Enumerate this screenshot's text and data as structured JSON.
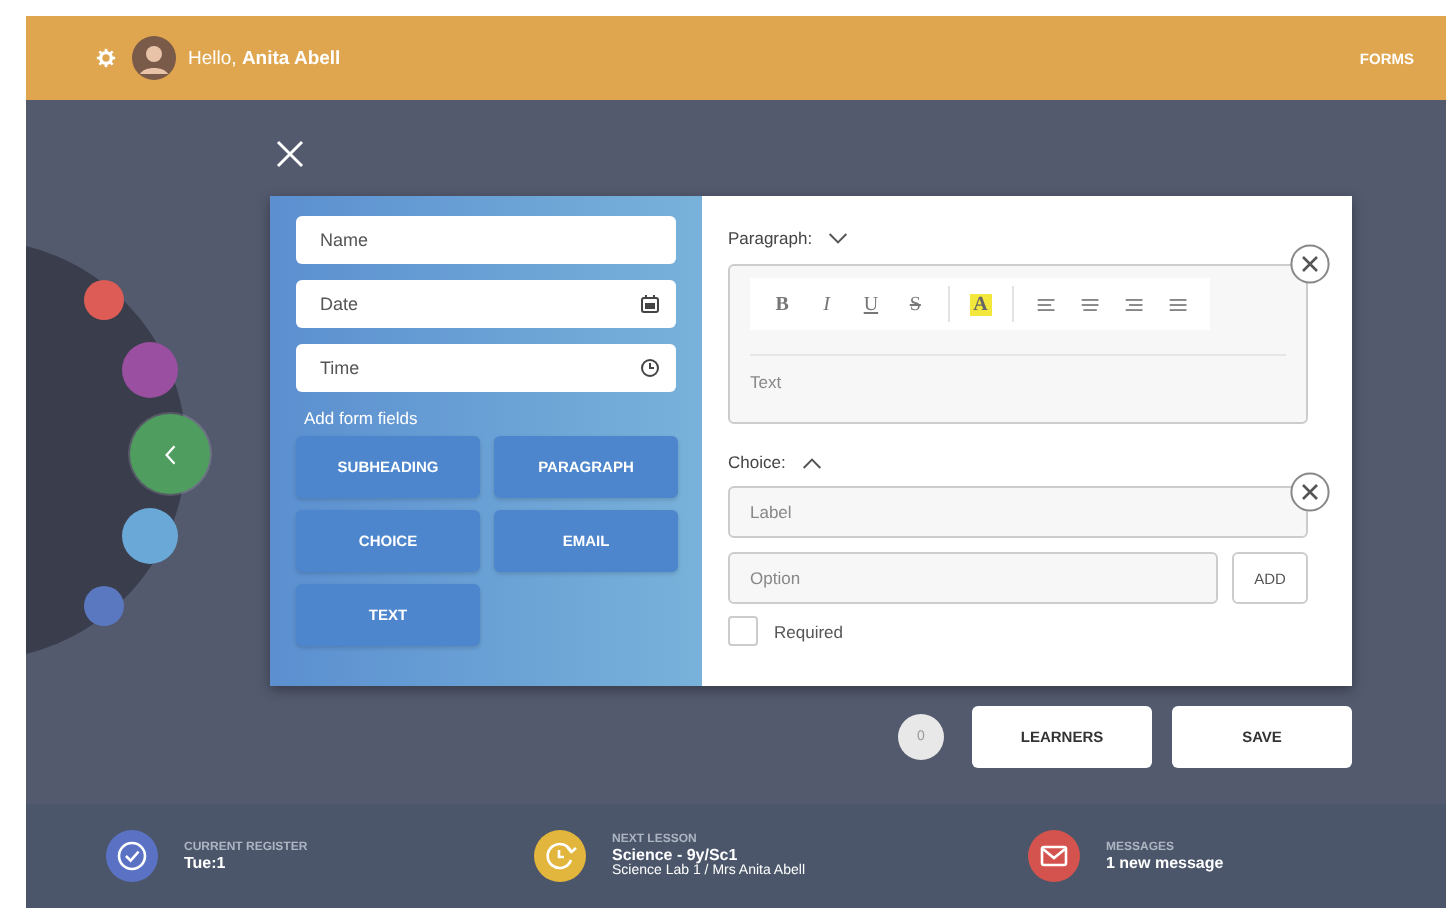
{
  "header": {
    "greeting": "Hello, **Anita Abell**",
    "nav_link": "FORMS"
  },
  "wheel_dots": [
    {
      "color": "#dd5c55",
      "selected": false
    },
    {
      "color": "#9a4fa0",
      "selected": false
    },
    {
      "color": "#4f9e5f",
      "selected": true
    },
    {
      "color": "#6aa8d8",
      "selected": false
    },
    {
      "color": "#5a78c0",
      "selected": false
    }
  ],
  "form_panel": {
    "fields": [
      {
        "placeholder": "Name",
        "kind": "text"
      },
      {
        "placeholder": "Date",
        "kind": "date"
      },
      {
        "placeholder": "Time",
        "kind": "time"
      }
    ],
    "add_label": "Add form fields",
    "add_buttons": [
      "SUBHEADING",
      "PARAGRAPH",
      "CHOICE",
      "EMAIL",
      "TEXT"
    ]
  },
  "paragraph_block": {
    "title": "Paragraph:",
    "expanded": false,
    "format_buttons": [
      {
        "label": "B",
        "kind": "bold"
      },
      {
        "label": "I",
        "kind": "italic"
      },
      {
        "label": "U",
        "kind": "underline"
      },
      {
        "label": "S",
        "kind": "strike"
      },
      {
        "label": "A",
        "kind": "highlight"
      }
    ],
    "text_placeholder": "Text"
  },
  "choice_block": {
    "title": "Choice:",
    "expanded": true,
    "label_placeholder": "Label",
    "option_placeholder": "Option",
    "add_button": "ADD",
    "required": {
      "label": "Required",
      "checked": false
    }
  },
  "actions": {
    "count": "0",
    "buttons": [
      "LEARNERS",
      "SAVE"
    ]
  },
  "status_bar": [
    {
      "kind": "register",
      "color": "#5b72c4",
      "caption": "CURRENT REGISTER",
      "value": "Tue:1"
    },
    {
      "kind": "lesson",
      "color": "#e2b63c",
      "caption": "NEXT LESSON",
      "value": "Science - 9y/Sc1",
      "detail": "Science Lab 1 / Mrs Anita Abell"
    },
    {
      "kind": "messages",
      "color": "#d4534f",
      "caption": "MESSAGES",
      "value": "1 new message"
    }
  ]
}
